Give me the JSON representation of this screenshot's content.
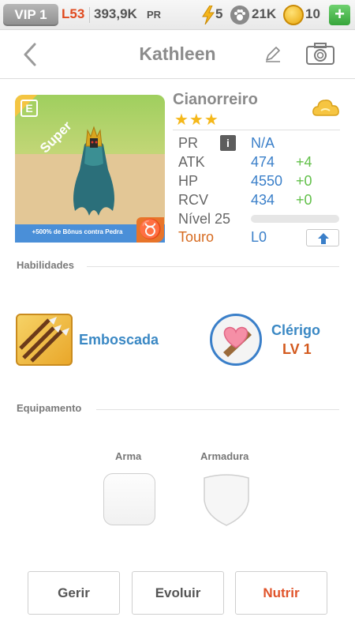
{
  "status_bar": {
    "vip_label": "VIP 1",
    "level_label": "L53",
    "power_value": "393,9K",
    "power_unit": "PR",
    "energy_value": "5",
    "paw_value": "21K",
    "coin_value": "10",
    "add_label": "+",
    "energy_icon": "lightning-icon",
    "paw_icon": "paw-icon",
    "coin_icon": "coin-icon"
  },
  "header": {
    "title": "Kathleen",
    "back_icon": "chevron-left-icon",
    "edit_icon": "pencil-icon",
    "camera_icon": "camera-icon"
  },
  "hero": {
    "rarity_label": "Super",
    "badge_letter": "E",
    "bonus_text": "+500% de Bônus contra Pedra",
    "zodiac_symbol": "♉",
    "name": "Cianorreiro",
    "stars": "★★★",
    "star_count": 3,
    "element_icon": "cloud-icon",
    "stats": {
      "pr_label": "PR",
      "pr_value": "N/A",
      "atk_label": "ATK",
      "atk_value": "474",
      "atk_bonus": "+4",
      "hp_label": "HP",
      "hp_value": "4550",
      "hp_bonus": "+0",
      "rcv_label": "RCV",
      "rcv_value": "434",
      "rcv_bonus": "+0",
      "level_label": "Nível 25",
      "level_progress": 0,
      "zodiac_label": "Touro",
      "zodiac_level": "L0"
    }
  },
  "abilities": {
    "section_title": "Habilidades",
    "skill_name": "Emboscada",
    "skill_icon": "arrows-icon",
    "class_name": "Clérigo",
    "class_level": "LV 1",
    "class_icon": "heart-shield-icon"
  },
  "equipment": {
    "section_title": "Equipamento",
    "weapon_label": "Arma",
    "armor_label": "Armadura"
  },
  "actions": {
    "manage_label": "Gerir",
    "evolve_label": "Evoluir",
    "feed_label": "Nutrir"
  },
  "colors": {
    "accent_blue": "#3a7fc9",
    "bonus_green": "#62c04a",
    "zodiac_orange": "#d66a1f",
    "feed_red": "#e0532a",
    "gold": "#f5b81a"
  }
}
